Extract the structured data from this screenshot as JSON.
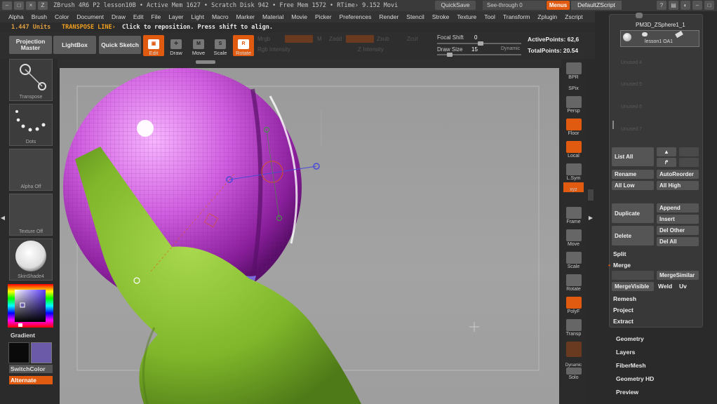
{
  "titlebar": {
    "title": "ZBrush 4R6 P2   lesson10B   • Active Mem 1627 • Scratch Disk 942 • Free Mem 1572 • RTime› 9.152 Movi",
    "quicksave": "QuickSave",
    "seethrough": "See-through  0",
    "menus": "Menus",
    "script": "DefaultZScript"
  },
  "menubar": [
    "Alpha",
    "Brush",
    "Color",
    "Document",
    "Draw",
    "Edit",
    "File",
    "Layer",
    "Light",
    "Macro",
    "Marker",
    "Material",
    "Movie",
    "Picker",
    "Preferences",
    "Render",
    "Stencil",
    "Stroke",
    "Texture",
    "Tool",
    "Transform",
    "Zplugin",
    "Zscript"
  ],
  "info": {
    "units": "1.447 Units",
    "mode": "TRANSPOSE LINE›",
    "hint": "Click to reposition. Press shift to align."
  },
  "shelf": {
    "projection_master": "Projection Master",
    "lightbox": "LightBox",
    "quick_sketch": "Quick Sketch",
    "tools": [
      {
        "label": "Edit",
        "icon": "edit-icon",
        "glyph": "▣",
        "active": true
      },
      {
        "label": "Draw",
        "icon": "draw-icon",
        "glyph": "✛",
        "active": false
      },
      {
        "label": "Move",
        "icon": "move-icon",
        "glyph": "M",
        "active": false
      },
      {
        "label": "Scale",
        "icon": "scale-icon",
        "glyph": "S",
        "active": false
      },
      {
        "label": "Rotate",
        "icon": "rotate-icon",
        "glyph": "R",
        "active": true
      }
    ],
    "mrgb": "Mrgb",
    "rgb": "Rgb",
    "m": "M",
    "zadd": "Zadd",
    "zsub": "Zsub",
    "zcut": "Zcut",
    "rgb_intensity": "Rgb Intensity",
    "z_intensity": "Z Intensity",
    "focal_shift_label": "Focal Shift",
    "focal_shift_value": "0",
    "draw_size_label": "Draw Size",
    "draw_size_value": "15",
    "dynamic": "Dynamic",
    "active_points": "ActivePoints: 62,6",
    "total_points": "TotalPoints: 20.54"
  },
  "leftpal": {
    "transpose": "Transpose",
    "dots": "Dots",
    "alpha_off": "Alpha Off",
    "texture_off": "Texture Off",
    "material": "SkinShade4",
    "gradient": "Gradient",
    "switchcolor": "SwitchColor",
    "alternate": "Alternate",
    "main_color": "#6a5aa8",
    "secondary_color": "#0a0a0a"
  },
  "rightshelf": [
    {
      "label": "BPR",
      "icon": "bpr-icon"
    },
    {
      "label": "SPix",
      "icon": "spix-icon"
    },
    {
      "label": "Persp",
      "icon": "persp-icon"
    },
    {
      "label": "Floor",
      "icon": "floor-icon"
    },
    {
      "label": "Local",
      "icon": "local-icon"
    },
    {
      "label": "L.Sym",
      "icon": "lsym-icon"
    },
    {
      "label": "xyz",
      "icon": "xyz-icon"
    },
    {
      "label": "Frame",
      "icon": "frame-icon"
    },
    {
      "label": "Move",
      "icon": "move-view-icon"
    },
    {
      "label": "Scale",
      "icon": "scale-view-icon"
    },
    {
      "label": "Rotate",
      "icon": "rotate-view-icon"
    },
    {
      "label": "PolyF",
      "icon": "polyf-icon"
    },
    {
      "label": "Transp",
      "icon": "transp-icon"
    },
    {
      "label": "Dynamic",
      "icon": "dynamic-icon"
    },
    {
      "label": "Solo",
      "icon": "solo-icon"
    }
  ],
  "subtool": {
    "name": "PM3D_ZSphere1_1",
    "item": "lesson1 OA1",
    "ghosts": [
      "Unused 4",
      "Unused 5",
      "Unused 6",
      "Unused 7"
    ],
    "list_all": "List All",
    "rename": "Rename",
    "autoreorder": "AutoReorder",
    "all_low": "All Low",
    "all_high": "All High",
    "duplicate": "Duplicate",
    "append": "Append",
    "insert": "Insert",
    "delete": "Delete",
    "del_other": "Del Other",
    "del_all": "Del All",
    "split": "Split",
    "merge": "Merge",
    "mergesimilar": "MergeSimilar",
    "mergevisible": "MergeVisible",
    "weld": "Weld",
    "uv": "Uv",
    "remesh": "Remesh",
    "project": "Project",
    "extract": "Extract"
  },
  "sections": [
    "Geometry",
    "Layers",
    "FiberMesh",
    "Geometry HD",
    "Preview"
  ]
}
